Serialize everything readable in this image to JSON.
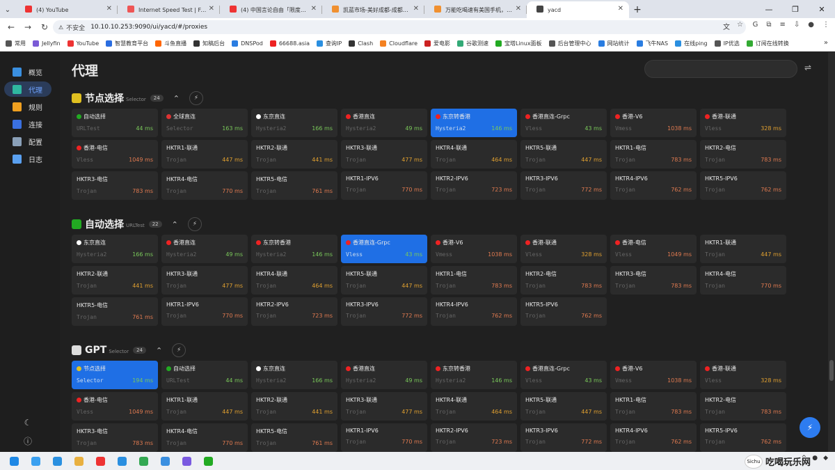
{
  "browser": {
    "tabs": [
      {
        "title": "(4) YouTube",
        "color": "#e33"
      },
      {
        "title": "Internet Speed Test | Fast.com",
        "color": "#e55"
      },
      {
        "title": "(4) 中国言论自由「限度」在哪",
        "color": "#e33"
      },
      {
        "title": "凯蓝市场-美好成都-成都二手交易",
        "color": "#f09030"
      },
      {
        "title": "万能吃喝速有美国手机，帮我找",
        "color": "#f09030"
      },
      {
        "title": "yacd",
        "color": "#444",
        "active": true
      }
    ],
    "new_tab": "+",
    "url": "10.10.10.253:9090/ui/yacd/#/proxies",
    "insecure": "不安全",
    "bookmarks": [
      {
        "label": "常用",
        "color": "#555"
      },
      {
        "label": "Jellyfin",
        "color": "#7b5bd6"
      },
      {
        "label": "YouTube",
        "color": "#e33"
      },
      {
        "label": "智慧教育平台",
        "color": "#2a6de0"
      },
      {
        "label": "斗鱼直播",
        "color": "#f60"
      },
      {
        "label": "知稿后台",
        "color": "#333"
      },
      {
        "label": "DNSPod",
        "color": "#2a7de1"
      },
      {
        "label": "66688.asia",
        "color": "#e22"
      },
      {
        "label": "查询IP",
        "color": "#2a8fe0"
      },
      {
        "label": "Clash",
        "color": "#333"
      },
      {
        "label": "Cloudflare",
        "color": "#f48120"
      },
      {
        "label": "爱电影",
        "color": "#c22"
      },
      {
        "label": "谷歌测速",
        "color": "#3a7"
      },
      {
        "label": "宝塔Linux面板",
        "color": "#2a2"
      },
      {
        "label": "后台管理中心",
        "color": "#555"
      },
      {
        "label": "网站统计",
        "color": "#2a7de1"
      },
      {
        "label": "飞牛NAS",
        "color": "#2a7de1"
      },
      {
        "label": "在线ping",
        "color": "#2a8fe0"
      },
      {
        "label": "IP优选",
        "color": "#555"
      },
      {
        "label": "订阅在线转换",
        "color": "#3a3"
      }
    ],
    "more": "»"
  },
  "sidebar": {
    "items": [
      {
        "label": "概览",
        "color": "#3a8fe0"
      },
      {
        "label": "代理",
        "color": "#2fb7a0",
        "active": true
      },
      {
        "label": "规则",
        "color": "#f0a020"
      },
      {
        "label": "连接",
        "color": "#3a70e0"
      },
      {
        "label": "配置",
        "color": "#8aa0b8"
      },
      {
        "label": "日志",
        "color": "#5aa0f0"
      }
    ]
  },
  "page": {
    "title": "代理"
  },
  "groups": [
    {
      "name": "节点选择",
      "type": "Selector",
      "count": "24",
      "icon_color": "#e0c020",
      "proxies": [
        {
          "n": "自动选择",
          "t": "URLTest",
          "d": "44 ms",
          "f": "#2a2"
        },
        {
          "n": "全球直连",
          "t": "Selector",
          "d": "163 ms",
          "f": "#d33"
        },
        {
          "n": "东京直连",
          "t": "Hysteria2",
          "d": "166 ms",
          "f": "#fff"
        },
        {
          "n": "香港直连",
          "t": "Hysteria2",
          "d": "49 ms",
          "f": "#e22"
        },
        {
          "n": "东京转香港",
          "t": "Hysteria2",
          "d": "146 ms",
          "f": "#e22",
          "sel": true
        },
        {
          "n": "香港直连-Grpc",
          "t": "Vless",
          "d": "43 ms",
          "f": "#e22"
        },
        {
          "n": "香港-V6",
          "t": "Vmess",
          "d": "1038 ms",
          "f": "#e22"
        },
        {
          "n": "香港-联通",
          "t": "Vless",
          "d": "328 ms",
          "f": "#e22"
        },
        {
          "n": "香港-电信",
          "t": "Vless",
          "d": "1049 ms",
          "f": "#e22"
        },
        {
          "n": "HKTR1-联通",
          "t": "Trojan",
          "d": "447 ms"
        },
        {
          "n": "HKTR2-联通",
          "t": "Trojan",
          "d": "441 ms"
        },
        {
          "n": "HKTR3-联通",
          "t": "Trojan",
          "d": "477 ms"
        },
        {
          "n": "HKTR4-联通",
          "t": "Trojan",
          "d": "464 ms"
        },
        {
          "n": "HKTR5-联通",
          "t": "Trojan",
          "d": "447 ms"
        },
        {
          "n": "HKTR1-电信",
          "t": "Trojan",
          "d": "783 ms"
        },
        {
          "n": "HKTR2-电信",
          "t": "Trojan",
          "d": "783 ms"
        },
        {
          "n": "HKTR3-电信",
          "t": "Trojan",
          "d": "783 ms"
        },
        {
          "n": "HKTR4-电信",
          "t": "Trojan",
          "d": "770 ms"
        },
        {
          "n": "HKTR5-电信",
          "t": "Trojan",
          "d": "761 ms"
        },
        {
          "n": "HKTR1-IPV6",
          "t": "Trojan",
          "d": "770 ms"
        },
        {
          "n": "HKTR2-IPV6",
          "t": "Trojan",
          "d": "723 ms"
        },
        {
          "n": "HKTR3-IPV6",
          "t": "Trojan",
          "d": "772 ms"
        },
        {
          "n": "HKTR4-IPV6",
          "t": "Trojan",
          "d": "762 ms"
        },
        {
          "n": "HKTR5-IPV6",
          "t": "Trojan",
          "d": "762 ms"
        }
      ]
    },
    {
      "name": "自动选择",
      "type": "URLTest",
      "count": "22",
      "icon_color": "#2a2",
      "proxies": [
        {
          "n": "东京直连",
          "t": "Hysteria2",
          "d": "166 ms",
          "f": "#fff"
        },
        {
          "n": "香港直连",
          "t": "Hysteria2",
          "d": "49 ms",
          "f": "#e22"
        },
        {
          "n": "东京转香港",
          "t": "Hysteria2",
          "d": "146 ms",
          "f": "#e22"
        },
        {
          "n": "香港直连-Grpc",
          "t": "Vless",
          "d": "43 ms",
          "f": "#e22",
          "sel": true
        },
        {
          "n": "香港-V6",
          "t": "Vmess",
          "d": "1038 ms",
          "f": "#e22"
        },
        {
          "n": "香港-联通",
          "t": "Vless",
          "d": "328 ms",
          "f": "#e22"
        },
        {
          "n": "香港-电信",
          "t": "Vless",
          "d": "1049 ms",
          "f": "#e22"
        },
        {
          "n": "HKTR1-联通",
          "t": "Trojan",
          "d": "447 ms"
        },
        {
          "n": "HKTR2-联通",
          "t": "Trojan",
          "d": "441 ms"
        },
        {
          "n": "HKTR3-联通",
          "t": "Trojan",
          "d": "477 ms"
        },
        {
          "n": "HKTR4-联通",
          "t": "Trojan",
          "d": "464 ms"
        },
        {
          "n": "HKTR5-联通",
          "t": "Trojan",
          "d": "447 ms"
        },
        {
          "n": "HKTR1-电信",
          "t": "Trojan",
          "d": "783 ms"
        },
        {
          "n": "HKTR2-电信",
          "t": "Trojan",
          "d": "783 ms"
        },
        {
          "n": "HKTR3-电信",
          "t": "Trojan",
          "d": "783 ms"
        },
        {
          "n": "HKTR4-电信",
          "t": "Trojan",
          "d": "770 ms"
        },
        {
          "n": "HKTR5-电信",
          "t": "Trojan",
          "d": "761 ms"
        },
        {
          "n": "HKTR1-IPV6",
          "t": "Trojan",
          "d": "770 ms"
        },
        {
          "n": "HKTR2-IPV6",
          "t": "Trojan",
          "d": "723 ms"
        },
        {
          "n": "HKTR3-IPV6",
          "t": "Trojan",
          "d": "772 ms"
        },
        {
          "n": "HKTR4-IPV6",
          "t": "Trojan",
          "d": "762 ms"
        },
        {
          "n": "HKTR5-IPV6",
          "t": "Trojan",
          "d": "762 ms"
        }
      ]
    },
    {
      "name": "GPT",
      "type": "Selector",
      "count": "24",
      "icon_color": "#ddd",
      "proxies": [
        {
          "n": "节点选择",
          "t": "Selector",
          "d": "194 ms",
          "f": "#e0c020",
          "sel": true
        },
        {
          "n": "自动选择",
          "t": "URLTest",
          "d": "44 ms",
          "f": "#2a2"
        },
        {
          "n": "东京直连",
          "t": "Hysteria2",
          "d": "166 ms",
          "f": "#fff"
        },
        {
          "n": "香港直连",
          "t": "Hysteria2",
          "d": "49 ms",
          "f": "#e22"
        },
        {
          "n": "东京转香港",
          "t": "Hysteria2",
          "d": "146 ms",
          "f": "#e22"
        },
        {
          "n": "香港直连-Grpc",
          "t": "Vless",
          "d": "43 ms",
          "f": "#e22"
        },
        {
          "n": "香港-V6",
          "t": "Vmess",
          "d": "1038 ms",
          "f": "#e22"
        },
        {
          "n": "香港-联通",
          "t": "Vless",
          "d": "328 ms",
          "f": "#e22"
        },
        {
          "n": "香港-电信",
          "t": "Vless",
          "d": "1049 ms",
          "f": "#e22"
        },
        {
          "n": "HKTR1-联通",
          "t": "Trojan",
          "d": "447 ms"
        },
        {
          "n": "HKTR2-联通",
          "t": "Trojan",
          "d": "441 ms"
        },
        {
          "n": "HKTR3-联通",
          "t": "Trojan",
          "d": "477 ms"
        },
        {
          "n": "HKTR4-联通",
          "t": "Trojan",
          "d": "464 ms"
        },
        {
          "n": "HKTR5-联通",
          "t": "Trojan",
          "d": "447 ms"
        },
        {
          "n": "HKTR1-电信",
          "t": "Trojan",
          "d": "783 ms"
        },
        {
          "n": "HKTR2-电信",
          "t": "Trojan",
          "d": "783 ms"
        },
        {
          "n": "HKTR3-电信",
          "t": "Trojan",
          "d": "783 ms"
        },
        {
          "n": "HKTR4-电信",
          "t": "Trojan",
          "d": "770 ms"
        },
        {
          "n": "HKTR5-电信",
          "t": "Trojan",
          "d": "761 ms"
        },
        {
          "n": "HKTR1-IPV6",
          "t": "Trojan",
          "d": "770 ms"
        },
        {
          "n": "HKTR2-IPV6",
          "t": "Trojan",
          "d": "723 ms"
        },
        {
          "n": "HKTR3-IPV6",
          "t": "Trojan",
          "d": "772 ms"
        },
        {
          "n": "HKTR4-IPV6",
          "t": "Trojan",
          "d": "762 ms"
        },
        {
          "n": "HKTR5-IPV6",
          "t": "Trojan",
          "d": "762 ms"
        }
      ]
    }
  ],
  "colors": {
    "fast": "#7ac95a",
    "medium": "#e0a030",
    "slow": "#e07a50",
    "accent": "#1f6fe5"
  },
  "taskbar": {
    "icons": [
      "#1e88e5",
      "#3aa0f0",
      "#2a90e0",
      "#e8b040",
      "#e33",
      "#2a8fe0",
      "#34a853",
      "#3a8fe0",
      "#7a5ae0",
      "#2a2"
    ]
  },
  "watermark": {
    "badge": "Sichu",
    "text": "吃喝玩乐网"
  }
}
